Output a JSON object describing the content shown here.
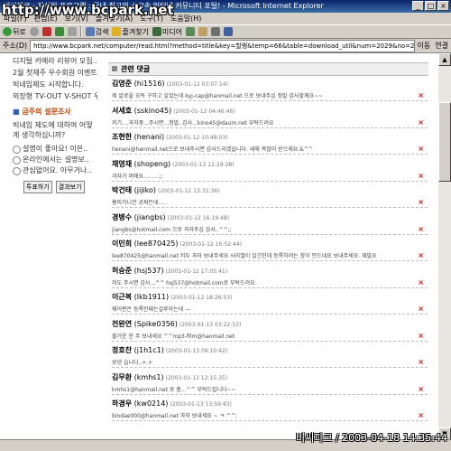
{
  "window": {
    "title": "비씨파크 - 지식인 프로그램 : 국내 최고의 소고속 인터넷 커뮤니티 포털! - Microsoft Internet Explorer",
    "watermark_top": "http://www.bcpark.net",
    "watermark_bottom": "비씨파크 / 2003-04-18 14:35:44"
  },
  "menu": [
    "파일(F)",
    "편집(E)",
    "보기(V)",
    "즐겨찾기(A)",
    "도구(T)",
    "도움말(H)"
  ],
  "toolbar": {
    "back": "뒤로",
    "search": "검색",
    "favorites": "즐겨찾기",
    "media": "미디어"
  },
  "address": {
    "label": "주소(D)",
    "url": "http://www.bcpark.net/computer/read.html?method=title&key=할랭&temp=66&table=download_util&num=2029&no=269",
    "go": "이동",
    "links": "연결"
  },
  "sidebar": {
    "items": [
      "디지털 카메라 리뷰어 모집..",
      "2월 첫재주 우수회원 이벤트..",
      "빅네임제도 시작합니다.",
      "외장형 TV-OUT V-SHOT 우.."
    ],
    "poll_title": "금주의 설문조사",
    "poll_question": "빅네임 제도에 대하여 어떻게 생각하십니까?",
    "poll_options": [
      "설명이 좋아요! 이븐..",
      "온라인에서는 설명보..",
      "관심없어요. 아무거나.."
    ],
    "vote_button": "투표하기",
    "results_button": "결과보기"
  },
  "comments_header": "관련 댓글",
  "comments": [
    {
      "name": "김영준",
      "id": "(hi1516)",
      "date": "(2003-01-12 03:07:14)",
      "text": "제 알로올 요독 구하고 싶었는데 kyj-cap@hanmail.net 으로 보내주심 정말 감사할께요~~"
    },
    {
      "name": "서세호",
      "id": "(sskino45)",
      "date": "(2003-01-12 04:46:46)",
      "text": "저기....과자중...주시면...정말..감사...kino45@daum.net 부탁드려요"
    },
    {
      "name": "조현한",
      "id": "(henani)",
      "date": "(2003-01-12 10:48:03)",
      "text": "henani@hanmail.net으로 보내주시면 감사드리겠습니다. 새해 복많이 받으세요.&^^"
    },
    {
      "name": "채영재",
      "id": "(shopeng)",
      "date": "(2003-01-12 12:29:28)",
      "text": "과자가 머에요.........;;"
    },
    {
      "name": "박건태",
      "id": "(jijiko)",
      "date": "(2003-01-12 13:31:36)",
      "text": "홈피가니깐 공짜든데....."
    },
    {
      "name": "경병수",
      "id": "(jiangbs)",
      "date": "(2003-01-12 16:19:48)",
      "text": "jiangbs@hotmail.com 으로 과자주심 감사..^^;;"
    },
    {
      "name": "이민희",
      "id": "(lee870425)",
      "date": "(2003-01-12 16:52:44)",
      "text": "lee870425@hanmail.net 저두 과자 보내주세요 사리앨이 있긴한데 등록하려는 창이 안드네요 보내주세요. 재발요"
    },
    {
      "name": "허승준",
      "id": "(hsj537)",
      "date": "(2003-01-12 17:05:41)",
      "text": "저도 주시면 감사...^^ hsj537@hotmail.com로 부탁드려요."
    },
    {
      "name": "이근복",
      "id": "(lkb1911)",
      "date": "(2003-01-12 18:26:53)",
      "text": "쉐어판은 등록안돼는걸루아는데 ---"
    },
    {
      "name": "전완연",
      "id": "(Spike0356)",
      "date": "(2003-01-13 03:22:53)",
      "text": "즐거운 한 주 보내세요 ^^mp3-film@hanmail.net"
    },
    {
      "name": "정호찬",
      "id": "(j1h1c1)",
      "date": "(2003-01-13 09:10:42)",
      "text": "보낸 습니다..+.+"
    },
    {
      "name": "김무환",
      "id": "(kmhs1)",
      "date": "(2003-01-13 12:15:35)",
      "text": "kmhs1@hanmail.net 로 좀...^^ 부탁드립니다~~"
    },
    {
      "name": "하경우",
      "id": "(kw0214)",
      "date": "(2003-01-13 13:59:43)",
      "text": "bindae000@hanmail.net 과자 보내세요 ~ ㅋ ^^;"
    }
  ]
}
